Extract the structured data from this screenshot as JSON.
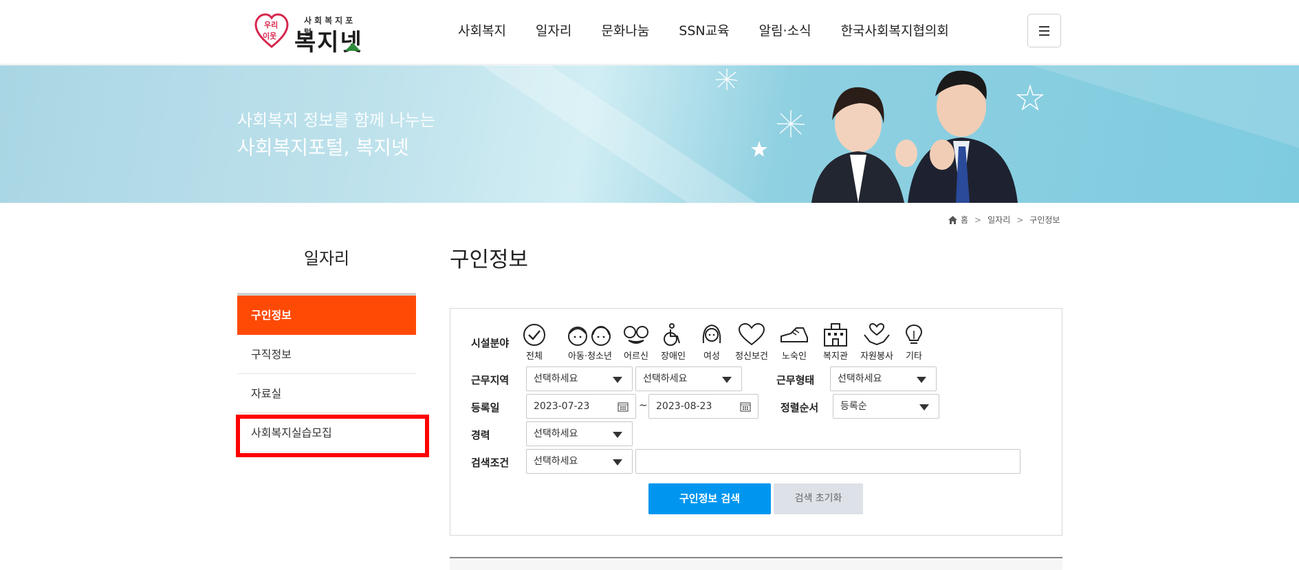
{
  "header": {
    "logo": {
      "sub": "사회복지포털",
      "main": "복지넷",
      "heart_text": "우리이웃"
    },
    "nav": [
      "사회복지",
      "일자리",
      "문화나눔",
      "SSN교육",
      "알림·소식",
      "한국사회복지협의회"
    ],
    "menu_icon": "hamburger-icon"
  },
  "banner": {
    "line1": "사회복지 정보를 함께 나누는",
    "line2": "사회복지포털, 복지넷"
  },
  "breadcrumb": {
    "home": "홈",
    "items": [
      "일자리",
      "구인정보"
    ]
  },
  "sidebar": {
    "title": "일자리",
    "items": [
      {
        "label": "구인정보",
        "active": true
      },
      {
        "label": "구직정보",
        "active": false
      },
      {
        "label": "자료실",
        "active": false
      },
      {
        "label": "사회복지실습모집",
        "active": false,
        "highlighted": true
      }
    ]
  },
  "main": {
    "title": "구인정보",
    "search": {
      "facility_label": "시설분야",
      "categories": [
        {
          "label": "전체",
          "icon": "check-circle-icon"
        },
        {
          "label": "아동·청소년",
          "icon": "children-icon"
        },
        {
          "label": "어르신",
          "icon": "elder-glasses-icon"
        },
        {
          "label": "장애인",
          "icon": "wheelchair-icon"
        },
        {
          "label": "여성",
          "icon": "woman-icon"
        },
        {
          "label": "정신보건",
          "icon": "heart-icon"
        },
        {
          "label": "노숙인",
          "icon": "shoe-icon"
        },
        {
          "label": "복지관",
          "icon": "building-icon"
        },
        {
          "label": "자원봉사",
          "icon": "hands-heart-icon"
        },
        {
          "label": "기타",
          "icon": "lightbulb-icon"
        }
      ],
      "region_label": "근무지역",
      "region_select_1": "선택하세요",
      "region_select_2": "선택하세요",
      "worktype_label": "근무형태",
      "worktype_select": "선택하세요",
      "date_label": "등록일",
      "date_from": "2023-07-23",
      "date_sep": "~",
      "date_to": "2023-08-23",
      "sort_label": "정렬순서",
      "sort_select": "등록순",
      "career_label": "경력",
      "career_select": "선택하세요",
      "condition_label": "검색조건",
      "condition_select": "선택하세요",
      "keyword_value": "",
      "search_button": "구인정보 검색",
      "reset_button": "검색 초기화"
    }
  },
  "colors": {
    "accent": "#ff4a06",
    "primary_button": "#0096f0",
    "highlight_box": "#ff0000"
  }
}
